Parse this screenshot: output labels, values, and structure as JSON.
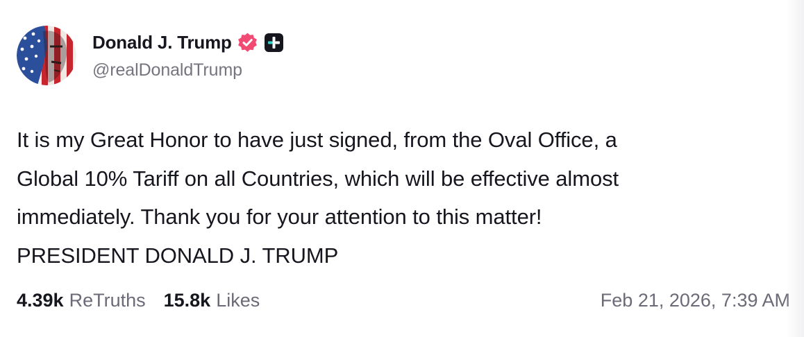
{
  "post": {
    "author": {
      "display_name": "Donald J. Trump",
      "handle": "@realDonaldTrump",
      "verified_icon": "verified-badge-icon",
      "plus_icon": "plus-badge-icon",
      "verified_color": "#f14a73"
    },
    "body_lines": [
      "It is my Great Honor to have just signed, from the Oval Office, a",
      "Global 10% Tariff on all Countries, which will be effective almost",
      "immediately. Thank you for your attention to this matter!",
      "PRESIDENT DONALD J. TRUMP"
    ],
    "stats": {
      "retruths_count": "4.39k",
      "retruths_label": "ReTruths",
      "likes_count": "15.8k",
      "likes_label": "Likes"
    },
    "timestamp": "Feb 21, 2026, 7:39 AM"
  }
}
